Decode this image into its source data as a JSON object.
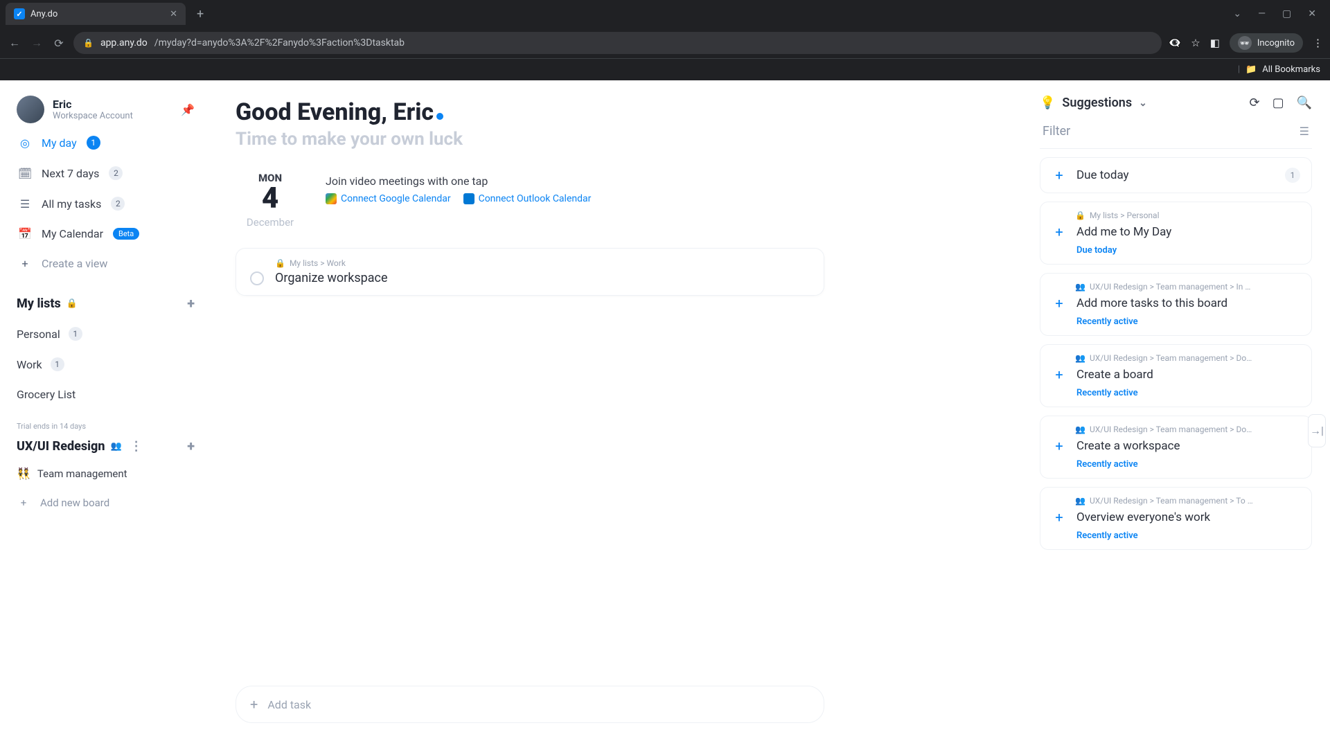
{
  "browser": {
    "tab_title": "Any.do",
    "url_host": "app.any.do",
    "url_path": "/myday?d=anydo%3A%2F%2Fanydo%3Faction%3Dtasktab",
    "incognito_label": "Incognito",
    "all_bookmarks": "All Bookmarks"
  },
  "sidebar": {
    "user_name": "Eric",
    "user_subtitle": "Workspace Account",
    "nav": [
      {
        "label": "My day",
        "count": "1",
        "active": true
      },
      {
        "label": "Next 7 days",
        "count": "2"
      },
      {
        "label": "All my tasks",
        "count": "2"
      },
      {
        "label": "My Calendar",
        "beta": "Beta"
      }
    ],
    "create_view": "Create a view",
    "my_lists_title": "My lists",
    "lists": [
      {
        "label": "Personal",
        "count": "1"
      },
      {
        "label": "Work",
        "count": "1"
      },
      {
        "label": "Grocery List"
      }
    ],
    "trial_text": "Trial ends in 14 days",
    "workspace_title": "UX/UI Redesign",
    "boards": [
      {
        "emoji": "👯",
        "label": "Team management"
      }
    ],
    "add_board": "Add new board"
  },
  "main": {
    "greeting": "Good Evening, Eric",
    "subgreeting": "Time to make your own luck",
    "date": {
      "dow": "MON",
      "num": "4",
      "month": "December"
    },
    "connect": {
      "title": "Join video meetings with one tap",
      "google": "Connect Google Calendar",
      "outlook": "Connect Outlook Calendar"
    },
    "task": {
      "breadcrumb": "My lists > Work",
      "title": "Organize workspace"
    },
    "add_task_placeholder": "Add task"
  },
  "right": {
    "suggestions_label": "Suggestions",
    "filter_label": "Filter",
    "due_today": {
      "label": "Due today",
      "count": "1"
    },
    "items": [
      {
        "bc": "My lists > Personal",
        "title": "Add me to My Day",
        "meta": "Due today"
      },
      {
        "bc": "UX/UI Redesign > Team management > In …",
        "title": "Add more tasks to this board",
        "meta": "Recently active"
      },
      {
        "bc": "UX/UI Redesign > Team management > Do…",
        "title": "Create a board",
        "meta": "Recently active"
      },
      {
        "bc": "UX/UI Redesign > Team management > Do…",
        "title": "Create a workspace",
        "meta": "Recently active"
      },
      {
        "bc": "UX/UI Redesign > Team management > To …",
        "title": "Overview everyone's work",
        "meta": "Recently active"
      }
    ]
  }
}
